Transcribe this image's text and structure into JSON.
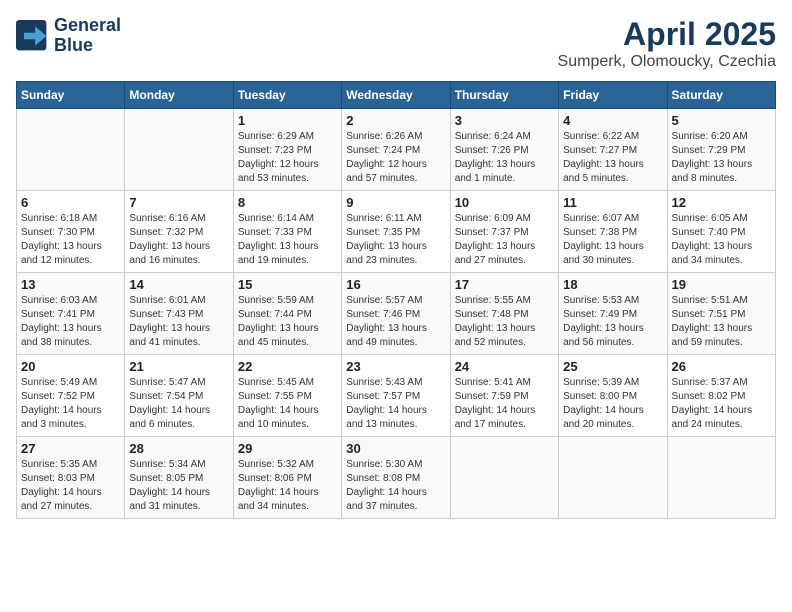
{
  "header": {
    "logo_line1": "General",
    "logo_line2": "Blue",
    "title": "April 2025",
    "subtitle": "Sumperk, Olomoucky, Czechia"
  },
  "weekdays": [
    "Sunday",
    "Monday",
    "Tuesday",
    "Wednesday",
    "Thursday",
    "Friday",
    "Saturday"
  ],
  "weeks": [
    [
      {
        "day": null
      },
      {
        "day": null
      },
      {
        "day": "1",
        "info": "Sunrise: 6:29 AM\nSunset: 7:23 PM\nDaylight: 12 hours\nand 53 minutes."
      },
      {
        "day": "2",
        "info": "Sunrise: 6:26 AM\nSunset: 7:24 PM\nDaylight: 12 hours\nand 57 minutes."
      },
      {
        "day": "3",
        "info": "Sunrise: 6:24 AM\nSunset: 7:26 PM\nDaylight: 13 hours\nand 1 minute."
      },
      {
        "day": "4",
        "info": "Sunrise: 6:22 AM\nSunset: 7:27 PM\nDaylight: 13 hours\nand 5 minutes."
      },
      {
        "day": "5",
        "info": "Sunrise: 6:20 AM\nSunset: 7:29 PM\nDaylight: 13 hours\nand 8 minutes."
      }
    ],
    [
      {
        "day": "6",
        "info": "Sunrise: 6:18 AM\nSunset: 7:30 PM\nDaylight: 13 hours\nand 12 minutes."
      },
      {
        "day": "7",
        "info": "Sunrise: 6:16 AM\nSunset: 7:32 PM\nDaylight: 13 hours\nand 16 minutes."
      },
      {
        "day": "8",
        "info": "Sunrise: 6:14 AM\nSunset: 7:33 PM\nDaylight: 13 hours\nand 19 minutes."
      },
      {
        "day": "9",
        "info": "Sunrise: 6:11 AM\nSunset: 7:35 PM\nDaylight: 13 hours\nand 23 minutes."
      },
      {
        "day": "10",
        "info": "Sunrise: 6:09 AM\nSunset: 7:37 PM\nDaylight: 13 hours\nand 27 minutes."
      },
      {
        "day": "11",
        "info": "Sunrise: 6:07 AM\nSunset: 7:38 PM\nDaylight: 13 hours\nand 30 minutes."
      },
      {
        "day": "12",
        "info": "Sunrise: 6:05 AM\nSunset: 7:40 PM\nDaylight: 13 hours\nand 34 minutes."
      }
    ],
    [
      {
        "day": "13",
        "info": "Sunrise: 6:03 AM\nSunset: 7:41 PM\nDaylight: 13 hours\nand 38 minutes."
      },
      {
        "day": "14",
        "info": "Sunrise: 6:01 AM\nSunset: 7:43 PM\nDaylight: 13 hours\nand 41 minutes."
      },
      {
        "day": "15",
        "info": "Sunrise: 5:59 AM\nSunset: 7:44 PM\nDaylight: 13 hours\nand 45 minutes."
      },
      {
        "day": "16",
        "info": "Sunrise: 5:57 AM\nSunset: 7:46 PM\nDaylight: 13 hours\nand 49 minutes."
      },
      {
        "day": "17",
        "info": "Sunrise: 5:55 AM\nSunset: 7:48 PM\nDaylight: 13 hours\nand 52 minutes."
      },
      {
        "day": "18",
        "info": "Sunrise: 5:53 AM\nSunset: 7:49 PM\nDaylight: 13 hours\nand 56 minutes."
      },
      {
        "day": "19",
        "info": "Sunrise: 5:51 AM\nSunset: 7:51 PM\nDaylight: 13 hours\nand 59 minutes."
      }
    ],
    [
      {
        "day": "20",
        "info": "Sunrise: 5:49 AM\nSunset: 7:52 PM\nDaylight: 14 hours\nand 3 minutes."
      },
      {
        "day": "21",
        "info": "Sunrise: 5:47 AM\nSunset: 7:54 PM\nDaylight: 14 hours\nand 6 minutes."
      },
      {
        "day": "22",
        "info": "Sunrise: 5:45 AM\nSunset: 7:55 PM\nDaylight: 14 hours\nand 10 minutes."
      },
      {
        "day": "23",
        "info": "Sunrise: 5:43 AM\nSunset: 7:57 PM\nDaylight: 14 hours\nand 13 minutes."
      },
      {
        "day": "24",
        "info": "Sunrise: 5:41 AM\nSunset: 7:59 PM\nDaylight: 14 hours\nand 17 minutes."
      },
      {
        "day": "25",
        "info": "Sunrise: 5:39 AM\nSunset: 8:00 PM\nDaylight: 14 hours\nand 20 minutes."
      },
      {
        "day": "26",
        "info": "Sunrise: 5:37 AM\nSunset: 8:02 PM\nDaylight: 14 hours\nand 24 minutes."
      }
    ],
    [
      {
        "day": "27",
        "info": "Sunrise: 5:35 AM\nSunset: 8:03 PM\nDaylight: 14 hours\nand 27 minutes."
      },
      {
        "day": "28",
        "info": "Sunrise: 5:34 AM\nSunset: 8:05 PM\nDaylight: 14 hours\nand 31 minutes."
      },
      {
        "day": "29",
        "info": "Sunrise: 5:32 AM\nSunset: 8:06 PM\nDaylight: 14 hours\nand 34 minutes."
      },
      {
        "day": "30",
        "info": "Sunrise: 5:30 AM\nSunset: 8:08 PM\nDaylight: 14 hours\nand 37 minutes."
      },
      {
        "day": null
      },
      {
        "day": null
      },
      {
        "day": null
      }
    ]
  ]
}
